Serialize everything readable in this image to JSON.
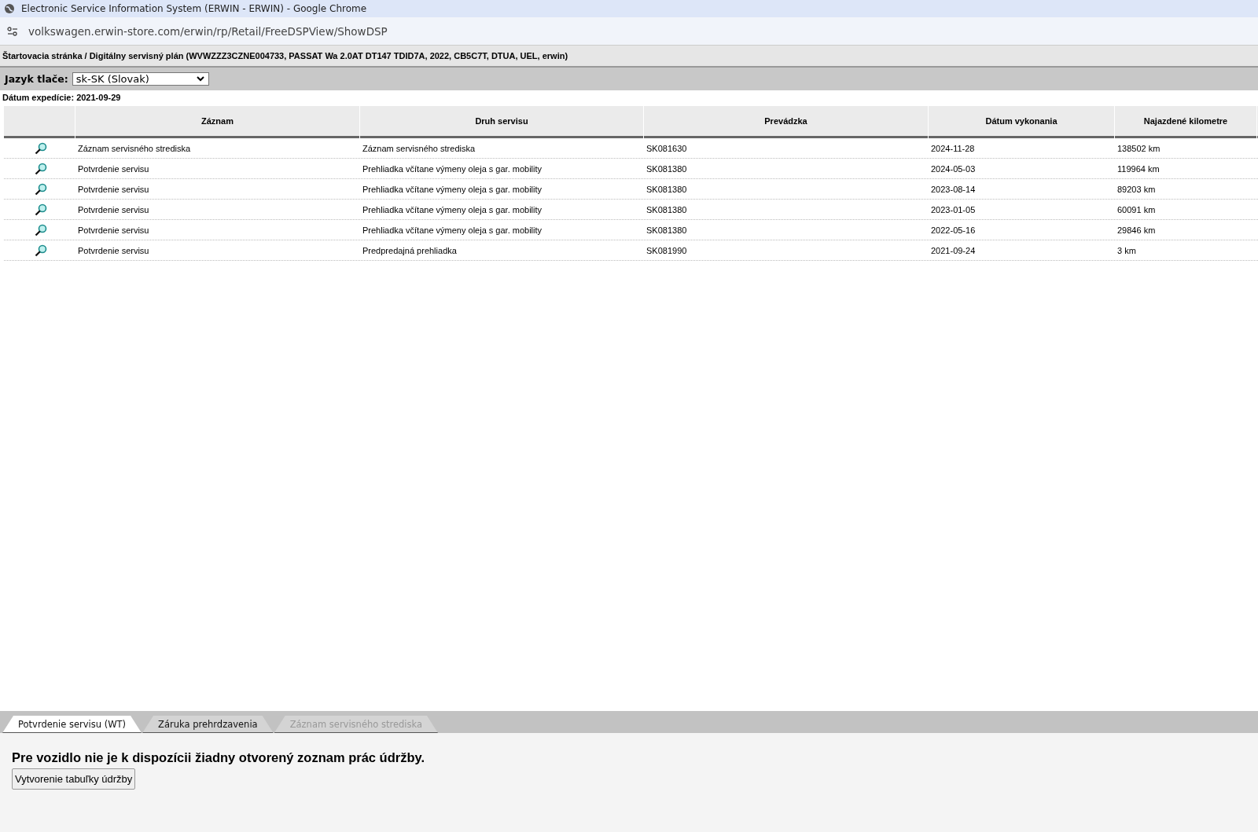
{
  "window": {
    "title": "Electronic Service Information System (ERWIN - ERWIN) - Google Chrome"
  },
  "address_bar": {
    "url": "volkswagen.erwin-store.com/erwin/rp/Retail/FreeDSPView/ShowDSP"
  },
  "breadcrumb": "Štartovacia stránka / Digitálny servisný plán (WVWZZZ3CZNE004733, PASSAT Wa 2.0AT DT147 TDID7A, 2022, CB5C7T, DTUA, UEL, erwin)",
  "print_language": {
    "label": "Jazyk tlače:",
    "value": "sk-SK (Slovak)"
  },
  "dispatch_date": "Dátum expedície: 2021-09-29",
  "table": {
    "columns": [
      "Záznam",
      "Druh servisu",
      "Prevádzka",
      "Dátum vykonania",
      "Najazdené kilometre"
    ],
    "rows": [
      {
        "record": "Záznam servisného strediska",
        "service_type": "Záznam servisného strediska",
        "workshop": "SK081630",
        "date": "2024-11-28",
        "mileage": "138502 km"
      },
      {
        "record": "Potvrdenie servisu",
        "service_type": "Prehliadka včítane výmeny oleja s gar. mobility",
        "workshop": "SK081380",
        "date": "2024-05-03",
        "mileage": "119964 km"
      },
      {
        "record": "Potvrdenie servisu",
        "service_type": "Prehliadka včítane výmeny oleja s gar. mobility",
        "workshop": "SK081380",
        "date": "2023-08-14",
        "mileage": "89203 km"
      },
      {
        "record": "Potvrdenie servisu",
        "service_type": "Prehliadka včítane výmeny oleja s gar. mobility",
        "workshop": "SK081380",
        "date": "2023-01-05",
        "mileage": "60091 km"
      },
      {
        "record": "Potvrdenie servisu",
        "service_type": "Prehliadka včítane výmeny oleja s gar. mobility",
        "workshop": "SK081380",
        "date": "2022-05-16",
        "mileage": "29846 km"
      },
      {
        "record": "Potvrdenie servisu",
        "service_type": "Predpredajná prehliadka",
        "workshop": "SK081990",
        "date": "2021-09-24",
        "mileage": "3 km"
      }
    ]
  },
  "tabs": [
    {
      "label": "Potvrdenie servisu (WT)",
      "selected": true,
      "disabled": false
    },
    {
      "label": "Záruka prehrdzavenia",
      "selected": false,
      "disabled": false
    },
    {
      "label": "Záznam servisného strediska",
      "selected": false,
      "disabled": true
    }
  ],
  "panel": {
    "message": "Pre vozidlo nie je k dispozícii žiadny otvorený zoznam prác údržby.",
    "button": "Vytvorenie tabuľky údržby"
  }
}
